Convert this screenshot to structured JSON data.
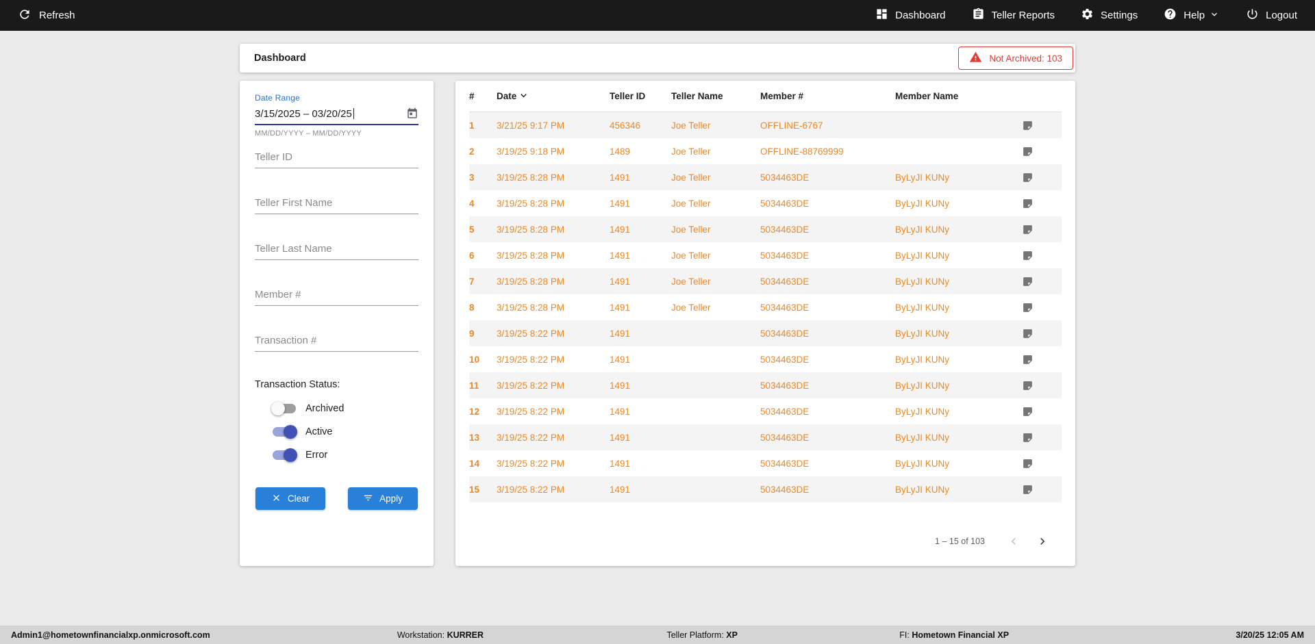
{
  "colors": {
    "accent_orange": "#F0871F",
    "alert_red": "#E53935",
    "button_blue": "#2980D9",
    "toggle_blue": "#3F51B5",
    "topbar_bg": "#1A1A1A"
  },
  "topbar": {
    "refresh_label": "Refresh",
    "items": [
      {
        "label": "Dashboard",
        "icon": "dashboard-icon"
      },
      {
        "label": "Teller Reports",
        "icon": "teller-reports-icon"
      },
      {
        "label": "Settings",
        "icon": "settings-icon"
      },
      {
        "label": "Help",
        "icon": "help-icon"
      },
      {
        "label": "Logout",
        "icon": "logout-icon"
      }
    ]
  },
  "header": {
    "title": "Dashboard",
    "not_archived_badge": "Not Archived: 103"
  },
  "filters": {
    "date_range": {
      "label": "Date Range",
      "value": "3/15/2025 – 03/20/25",
      "helper": "MM/DD/YYYY – MM/DD/YYYY"
    },
    "teller_id_placeholder": "Teller ID",
    "teller_first_name_placeholder": "Teller First Name",
    "teller_last_name_placeholder": "Teller Last Name",
    "member_placeholder": "Member #",
    "transaction_placeholder": "Transaction #",
    "status_label": "Transaction Status:",
    "toggles": [
      {
        "label": "Archived",
        "on": false
      },
      {
        "label": "Active",
        "on": true
      },
      {
        "label": "Error",
        "on": true
      }
    ],
    "clear_label": "Clear",
    "apply_label": "Apply"
  },
  "table": {
    "columns": {
      "num": "#",
      "date": "Date",
      "teller_id": "Teller ID",
      "teller_name": "Teller Name",
      "member": "Member #",
      "member_name": "Member Name"
    },
    "rows": [
      {
        "num": "1",
        "date": "3/21/25 9:17 PM",
        "teller_id": "456346",
        "teller_name": "Joe Teller",
        "member": "OFFLINE-6767",
        "member_name": ""
      },
      {
        "num": "2",
        "date": "3/19/25 9:18 PM",
        "teller_id": "1489",
        "teller_name": "Joe Teller",
        "member": "OFFLINE-88769999",
        "member_name": ""
      },
      {
        "num": "3",
        "date": "3/19/25 8:28 PM",
        "teller_id": "1491",
        "teller_name": "Joe Teller",
        "member": "5034463DE",
        "member_name": "ByLyJI KUNy"
      },
      {
        "num": "4",
        "date": "3/19/25 8:28 PM",
        "teller_id": "1491",
        "teller_name": "Joe Teller",
        "member": "5034463DE",
        "member_name": "ByLyJI KUNy"
      },
      {
        "num": "5",
        "date": "3/19/25 8:28 PM",
        "teller_id": "1491",
        "teller_name": "Joe Teller",
        "member": "5034463DE",
        "member_name": "ByLyJI KUNy"
      },
      {
        "num": "6",
        "date": "3/19/25 8:28 PM",
        "teller_id": "1491",
        "teller_name": "Joe Teller",
        "member": "5034463DE",
        "member_name": "ByLyJI KUNy"
      },
      {
        "num": "7",
        "date": "3/19/25 8:28 PM",
        "teller_id": "1491",
        "teller_name": "Joe Teller",
        "member": "5034463DE",
        "member_name": "ByLyJI KUNy"
      },
      {
        "num": "8",
        "date": "3/19/25 8:28 PM",
        "teller_id": "1491",
        "teller_name": "Joe Teller",
        "member": "5034463DE",
        "member_name": "ByLyJI KUNy"
      },
      {
        "num": "9",
        "date": "3/19/25 8:22 PM",
        "teller_id": "1491",
        "teller_name": "",
        "member": "5034463DE",
        "member_name": "ByLyJI KUNy"
      },
      {
        "num": "10",
        "date": "3/19/25 8:22 PM",
        "teller_id": "1491",
        "teller_name": "",
        "member": "5034463DE",
        "member_name": "ByLyJI KUNy"
      },
      {
        "num": "11",
        "date": "3/19/25 8:22 PM",
        "teller_id": "1491",
        "teller_name": "",
        "member": "5034463DE",
        "member_name": "ByLyJI KUNy"
      },
      {
        "num": "12",
        "date": "3/19/25 8:22 PM",
        "teller_id": "1491",
        "teller_name": "",
        "member": "5034463DE",
        "member_name": "ByLyJI KUNy"
      },
      {
        "num": "13",
        "date": "3/19/25 8:22 PM",
        "teller_id": "1491",
        "teller_name": "",
        "member": "5034463DE",
        "member_name": "ByLyJI KUNy"
      },
      {
        "num": "14",
        "date": "3/19/25 8:22 PM",
        "teller_id": "1491",
        "teller_name": "",
        "member": "5034463DE",
        "member_name": "ByLyJI KUNy"
      },
      {
        "num": "15",
        "date": "3/19/25 8:22 PM",
        "teller_id": "1491",
        "teller_name": "",
        "member": "5034463DE",
        "member_name": "ByLyJI KUNy"
      }
    ],
    "pagination": "1 – 15 of 103"
  },
  "statusbar": {
    "user": "Admin1@hometownfinancialxp.onmicrosoft.com",
    "workstation_label": "Workstation:",
    "workstation_value": "KURRER",
    "platform_label": "Teller Platform:",
    "platform_value": "XP",
    "fi_label": "FI:",
    "fi_value": "Hometown Financial XP",
    "datetime": "3/20/25 12:05 AM"
  }
}
